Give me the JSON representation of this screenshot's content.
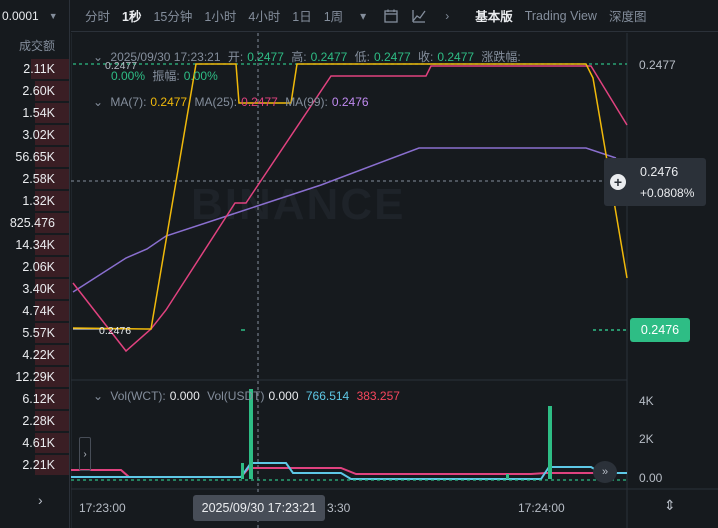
{
  "orderbook": {
    "price_step": "0.0001",
    "column_header": "成交额",
    "volumes": [
      {
        "value": "2.11K",
        "depth": 0.55
      },
      {
        "value": "2.60K",
        "depth": 0.5
      },
      {
        "value": "1.54K",
        "depth": 0.5
      },
      {
        "value": "3.02K",
        "depth": 0.5
      },
      {
        "value": "56.65K",
        "depth": 0.5
      },
      {
        "value": "2.58K",
        "depth": 0.5
      },
      {
        "value": "1.32K",
        "depth": 0.5
      },
      {
        "value": "825.476",
        "depth": 0.5
      },
      {
        "value": "14.34K",
        "depth": 0.5
      },
      {
        "value": "2.06K",
        "depth": 0.5
      },
      {
        "value": "3.40K",
        "depth": 0.5
      },
      {
        "value": "4.74K",
        "depth": 0.5
      },
      {
        "value": "5.57K",
        "depth": 0.5
      },
      {
        "value": "4.22K",
        "depth": 0.5
      },
      {
        "value": "12.29K",
        "depth": 0.5
      },
      {
        "value": "6.12K",
        "depth": 0.5
      },
      {
        "value": "2.28K",
        "depth": 0.5
      },
      {
        "value": "4.61K",
        "depth": 0.5
      },
      {
        "value": "2.21K",
        "depth": 0.5
      }
    ]
  },
  "toolbar": {
    "intervals": [
      "分时",
      "1秒",
      "15分钟",
      "1小时",
      "4小时",
      "1日",
      "1周"
    ],
    "active_interval": "1秒",
    "views": [
      "基本版",
      "Trading View",
      "深度图"
    ],
    "active_view": "基本版",
    "icons": [
      "chevron-down-icon",
      "indicator-icon",
      "chart-type-icon",
      "chevron-right-icon"
    ]
  },
  "ohlc_legend": {
    "datetime": "2025/09/30 17:23:21",
    "open_label": "开:",
    "open": "0.2477",
    "high_label": "高:",
    "high": "0.2477",
    "low_label": "低:",
    "low": "0.2477",
    "close_label": "收:",
    "close": "0.2477",
    "change_label": "涨跌幅:",
    "change": "0.00%",
    "amplitude_label": "振幅:",
    "amplitude": "0.00%",
    "high_marker": "0.2477",
    "low_marker": "0.2476"
  },
  "ma_legend": {
    "ma7_label": "MA(7):",
    "ma7": "0.2477",
    "ma25_label": "MA(25):",
    "ma25": "0.2477",
    "ma99_label": "MA(99):",
    "ma99": "0.2476"
  },
  "vol_legend": {
    "vol_wct_label": "Vol(WCT):",
    "vol_wct": "0.000",
    "vol_usdt_label": "Vol(USDT)",
    "vol_usdt": "0.000",
    "ma_a": "766.514",
    "ma_b": "383.257"
  },
  "price_axis": {
    "top_tick": "0.2477",
    "crosshair_price": "0.2476",
    "crosshair_change": "+0.0808%",
    "last_price": "0.2476"
  },
  "volume_axis": {
    "ticks": [
      "4K",
      "2K",
      "0.00"
    ]
  },
  "time_axis": {
    "ticks": [
      "17:23:00",
      "3:30",
      "17:24:00"
    ],
    "crosshair_time": "2025/09/30 17:23:21"
  },
  "watermark": "BINANCE",
  "colors": {
    "up": "#2ebd85",
    "down": "#f6465d",
    "ma7": "#f0b90b",
    "ma25": "#e0427f",
    "ma99": "#8a6fcf",
    "vol_ma_a": "#5ec8e6",
    "vol_ma_b": "#e0427f",
    "background": "#161a1e"
  }
}
